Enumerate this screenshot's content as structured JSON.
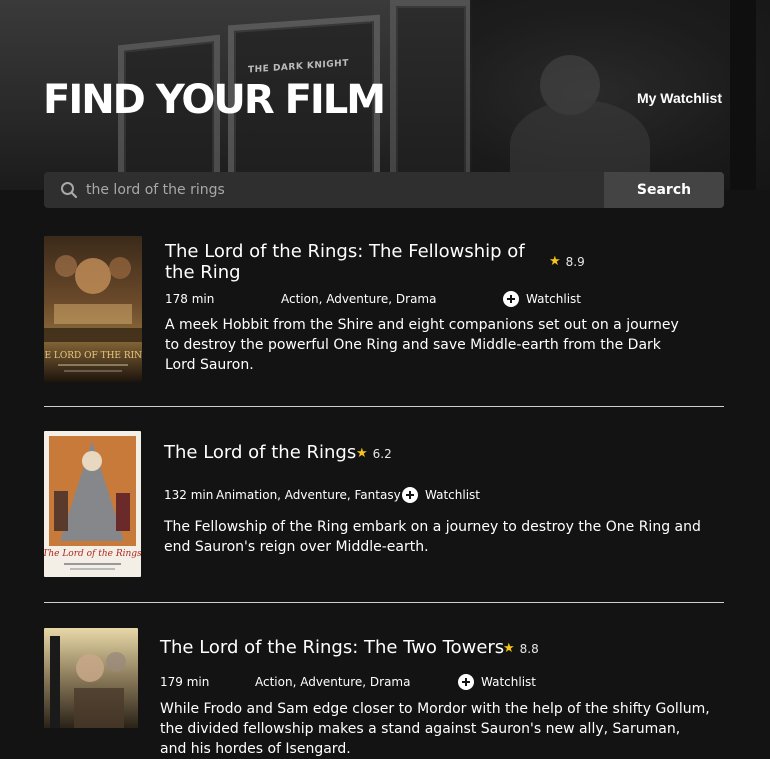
{
  "header": {
    "title": "FIND YOUR FILM",
    "watchlist_link": "My Watchlist",
    "backdrop_sign": "THE DARK KNIGHT"
  },
  "search": {
    "value": "the lord of the rings",
    "button_label": "Search",
    "icon": "search-icon"
  },
  "colors": {
    "background": "#131313",
    "search_bg": "#2f2f2f",
    "button_bg": "#444444",
    "star": "#f5c518"
  },
  "results": [
    {
      "title": "The Lord of the Rings: The Fellowship of the Ring",
      "rating": "8.9",
      "runtime": "178 min",
      "genres": "Action, Adventure, Drama",
      "watchlist_label": "Watchlist",
      "overview": "A meek Hobbit from the Shire and eight companions set out on a journey to destroy the powerful One Ring and save Middle-earth from the Dark Lord Sauron.",
      "poster_text": "THE LORD OF THE RINGS"
    },
    {
      "title": "The Lord of the Rings",
      "rating": "6.2",
      "runtime": "132 min",
      "genres": "Animation, Adventure, Fantasy",
      "watchlist_label": "Watchlist",
      "overview": "The Fellowship of the Ring embark on a journey to destroy the One Ring and end Sauron's reign over Middle-earth.",
      "poster_text": "The Lord of the Rings"
    },
    {
      "title": "The Lord of the Rings: The Two Towers",
      "rating": "8.8",
      "runtime": "179 min",
      "genres": "Action, Adventure, Drama",
      "watchlist_label": "Watchlist",
      "overview": "While Frodo and Sam edge closer to Mordor with the help of the shifty Gollum, the divided fellowship makes a stand against Sauron's new ally, Saruman, and his hordes of Isengard."
    }
  ]
}
